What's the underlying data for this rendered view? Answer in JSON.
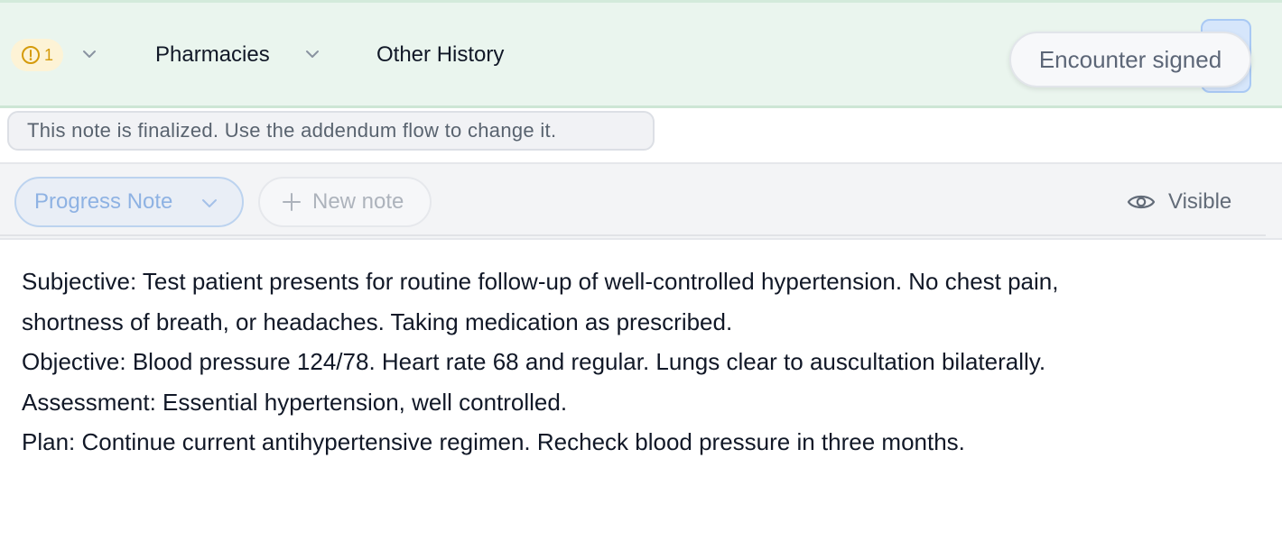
{
  "header": {
    "alert": {
      "count": "1",
      "icon": "alert-circle-icon",
      "color": "#d59b0b"
    },
    "nav": [
      {
        "label": "Pharmacies",
        "has_dropdown": true
      },
      {
        "label": "Other History",
        "has_dropdown": false
      }
    ],
    "status_badge": "Encounter signed",
    "background": "#eaf5ee"
  },
  "notice": {
    "text": "This note is finalized. Use the addendum flow to change it."
  },
  "toolbar": {
    "note_type": "Progress Note",
    "new_note_label": "New note",
    "visibility_label": "Visible",
    "visibility_icon": "eye-icon",
    "accent": "#8eb2e3"
  },
  "note": {
    "lines": [
      "Subjective: Test patient presents for routine follow-up of well-controlled hypertension. No chest pain,",
      "shortness of breath, or headaches. Taking medication as prescribed.",
      "Objective: Blood pressure 124/78. Heart rate 68 and regular. Lungs clear to auscultation bilaterally.",
      "Assessment: Essential hypertension, well controlled.",
      "Plan: Continue current antihypertensive regimen. Recheck blood pressure in three months."
    ]
  }
}
